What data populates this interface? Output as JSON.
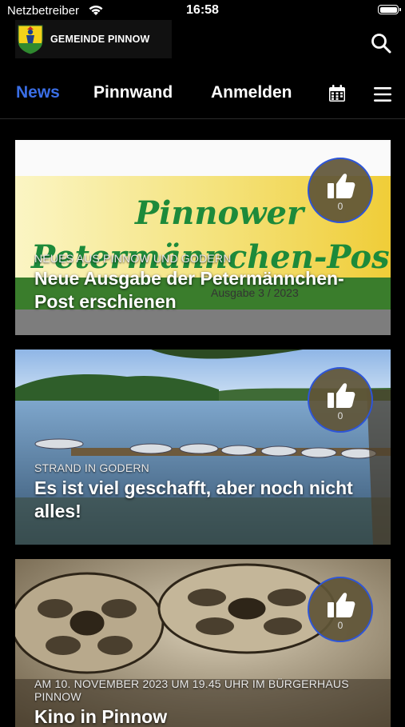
{
  "status": {
    "carrier": "Netzbetreiber",
    "time": "16:58"
  },
  "header": {
    "logo_text": "GEMEINDE PINNOW"
  },
  "nav": {
    "tabs": [
      "News",
      "Pinnwand",
      "Anmelden"
    ],
    "active": "News"
  },
  "colors": {
    "accent": "#3a6ee6",
    "like_border": "#2d55d8",
    "background": "#000000"
  },
  "cards": [
    {
      "category": "Neues aus Pinnow und Godern",
      "title": "Neue Ausgabe der Petermännchen-Post erschienen",
      "likes": "0",
      "image_text": {
        "line1": "Pinnower",
        "line2": "Petermännchen-Pos",
        "line3": "Ausgabe 3 / 2023"
      }
    },
    {
      "category": "Strand in Godern",
      "title": "Es ist viel geschafft, aber noch nicht alles!",
      "likes": "0"
    },
    {
      "category": "am 10. November 2023 um 19.45 Uhr im Bürgerhaus Pinnow",
      "title": "Kino in Pinnow",
      "likes": "0"
    }
  ]
}
